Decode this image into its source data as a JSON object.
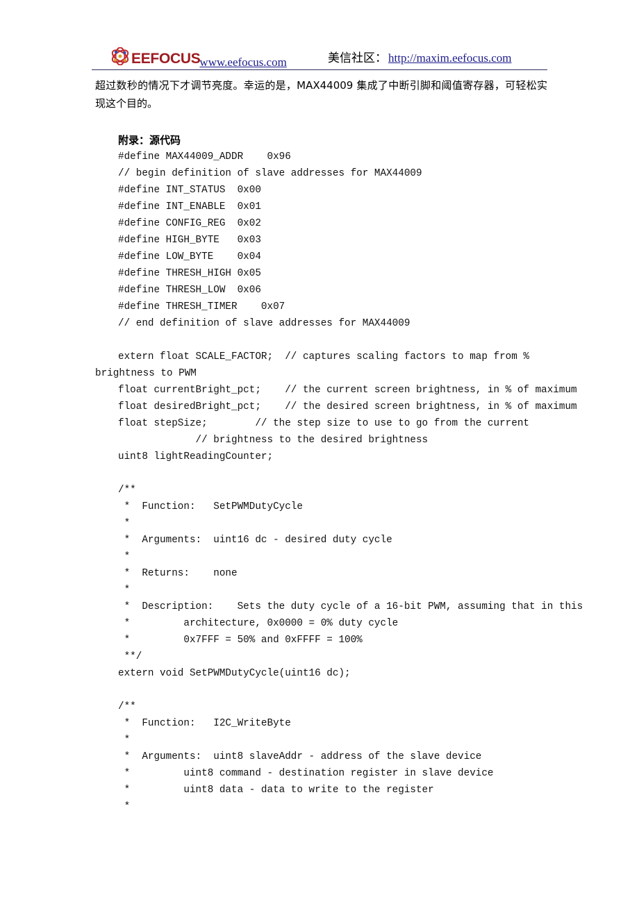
{
  "header": {
    "brand_name": "EEFOCUS",
    "brand_url": "www.eefocus.com",
    "right_label": "美信社区：",
    "right_url": "http://maxim.eefocus.com",
    "logo_icon": "atom-logo-icon",
    "brand_color": "#9e1b20",
    "link_color": "#1c1c8c",
    "rule_color": "#2f2f5f"
  },
  "body": {
    "paragraph": "超过数秒的情况下才调节亮度。幸运的是，MAX44009 集成了中断引脚和阈值寄存器，可轻松实现这个目的。",
    "section_title": "附录：源代码"
  },
  "code": {
    "lines": [
      {
        "text": "#define MAX44009_ADDR    0x96",
        "indent": true
      },
      {
        "text": "// begin definition of slave addresses for MAX44009",
        "indent": true
      },
      {
        "text": "#define INT_STATUS  0x00",
        "indent": true
      },
      {
        "text": "#define INT_ENABLE  0x01",
        "indent": true
      },
      {
        "text": "#define CONFIG_REG  0x02",
        "indent": true
      },
      {
        "text": "#define HIGH_BYTE   0x03",
        "indent": true
      },
      {
        "text": "#define LOW_BYTE    0x04",
        "indent": true
      },
      {
        "text": "#define THRESH_HIGH 0x05",
        "indent": true
      },
      {
        "text": "#define THRESH_LOW  0x06",
        "indent": true
      },
      {
        "text": "#define THRESH_TIMER    0x07",
        "indent": true
      },
      {
        "text": "// end definition of slave addresses for MAX44009",
        "indent": true
      },
      {
        "text": "",
        "indent": true
      },
      {
        "text": "extern float SCALE_FACTOR;  // captures scaling factors to map from %",
        "indent": true
      },
      {
        "text": "brightness to PWM",
        "indent": false
      },
      {
        "text": "float currentBright_pct;    // the current screen brightness, in % of maximum",
        "indent": true
      },
      {
        "text": "float desiredBright_pct;    // the desired screen brightness, in % of maximum",
        "indent": true
      },
      {
        "text": "float stepSize;        // the step size to use to go from the current",
        "indent": true
      },
      {
        "text": "             // brightness to the desired brightness",
        "indent": true
      },
      {
        "text": "uint8 lightReadingCounter;",
        "indent": true
      },
      {
        "text": "",
        "indent": true
      },
      {
        "text": "/**",
        "indent": true
      },
      {
        "text": " *  Function:   SetPWMDutyCycle",
        "indent": true
      },
      {
        "text": " *",
        "indent": true
      },
      {
        "text": " *  Arguments:  uint16 dc - desired duty cycle",
        "indent": true
      },
      {
        "text": " *",
        "indent": true
      },
      {
        "text": " *  Returns:    none",
        "indent": true
      },
      {
        "text": " *",
        "indent": true
      },
      {
        "text": " *  Description:    Sets the duty cycle of a 16-bit PWM, assuming that in this",
        "indent": true
      },
      {
        "text": " *         architecture, 0x0000 = 0% duty cycle",
        "indent": true
      },
      {
        "text": " *         0x7FFF = 50% and 0xFFFF = 100%",
        "indent": true
      },
      {
        "text": " **/",
        "indent": true
      },
      {
        "text": "extern void SetPWMDutyCycle(uint16 dc);",
        "indent": true
      },
      {
        "text": "",
        "indent": true
      },
      {
        "text": "/**",
        "indent": true
      },
      {
        "text": " *  Function:   I2C_WriteByte",
        "indent": true
      },
      {
        "text": " *",
        "indent": true
      },
      {
        "text": " *  Arguments:  uint8 slaveAddr - address of the slave device",
        "indent": true
      },
      {
        "text": " *         uint8 command - destination register in slave device",
        "indent": true
      },
      {
        "text": " *         uint8 data - data to write to the register",
        "indent": true
      },
      {
        "text": " *",
        "indent": true
      }
    ]
  }
}
